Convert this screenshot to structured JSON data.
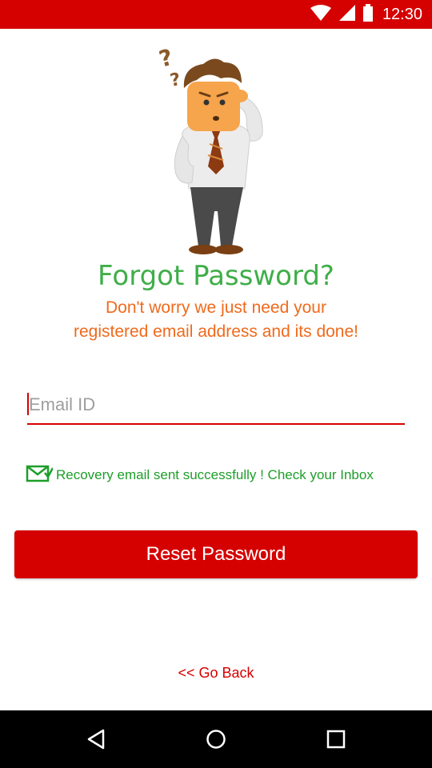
{
  "status_bar": {
    "time": "12:30",
    "icons": [
      "wifi-icon",
      "cellular-signal-icon",
      "battery-icon"
    ]
  },
  "illustration": {
    "name": "confused-man-illustration"
  },
  "heading": {
    "title": "Forgot Password?",
    "subtitle_line1": "Don't worry we just need your",
    "subtitle_line2": "registered email address and its done!"
  },
  "form": {
    "email_placeholder": "Email ID",
    "email_value": ""
  },
  "notice": {
    "icon": "mail-check-icon",
    "text": "Recovery email sent successfully ! Check your Inbox"
  },
  "actions": {
    "reset_label": "Reset Password",
    "back_label": "<< Go Back"
  },
  "navigation": {
    "icons": [
      "back-triangle-icon",
      "home-circle-icon",
      "recents-square-icon"
    ]
  },
  "colors": {
    "primary": "#d50000",
    "title_green": "#3fae49",
    "subtitle_orange": "#f06a1c",
    "success_green": "#1e9e2a"
  }
}
